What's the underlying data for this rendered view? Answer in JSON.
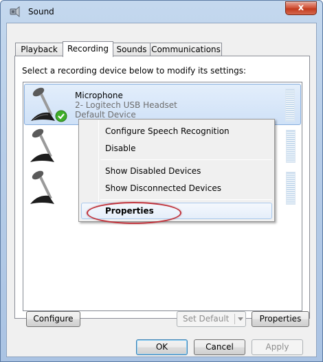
{
  "window": {
    "title": "Sound",
    "close_label": "x",
    "icon": "speaker-icon"
  },
  "tabs": [
    {
      "label": "Playback",
      "active": false
    },
    {
      "label": "Recording",
      "active": true
    },
    {
      "label": "Sounds",
      "active": false
    },
    {
      "label": "Communications",
      "active": false
    }
  ],
  "instruction": "Select a recording device below to modify its settings:",
  "devices": [
    {
      "name": "Microphone",
      "description": "2- Logitech USB Headset",
      "status": "Default Device",
      "icon": "microphone-icon",
      "badge": "green-check-icon",
      "selected": true
    },
    {
      "name": "",
      "description": "",
      "status": "",
      "icon": "microphone-icon",
      "selected": false
    },
    {
      "name": "",
      "description": "",
      "status": "",
      "icon": "microphone-icon",
      "selected": false
    }
  ],
  "context_menu": {
    "items": [
      {
        "label": "Configure Speech Recognition"
      },
      {
        "label": "Disable"
      },
      {
        "label": "Show Disabled Devices"
      },
      {
        "label": "Show Disconnected Devices"
      },
      {
        "label": "Properties",
        "bold": true,
        "hovered": true
      }
    ]
  },
  "buttons": {
    "configure": "Configure",
    "set_default": "Set Default",
    "properties": "Properties",
    "ok": "OK",
    "cancel": "Cancel",
    "apply": "Apply"
  },
  "colors": {
    "highlight_ellipse": "#c0313a",
    "selection_border": "#84acdd",
    "check_green": "#3fae2a"
  }
}
